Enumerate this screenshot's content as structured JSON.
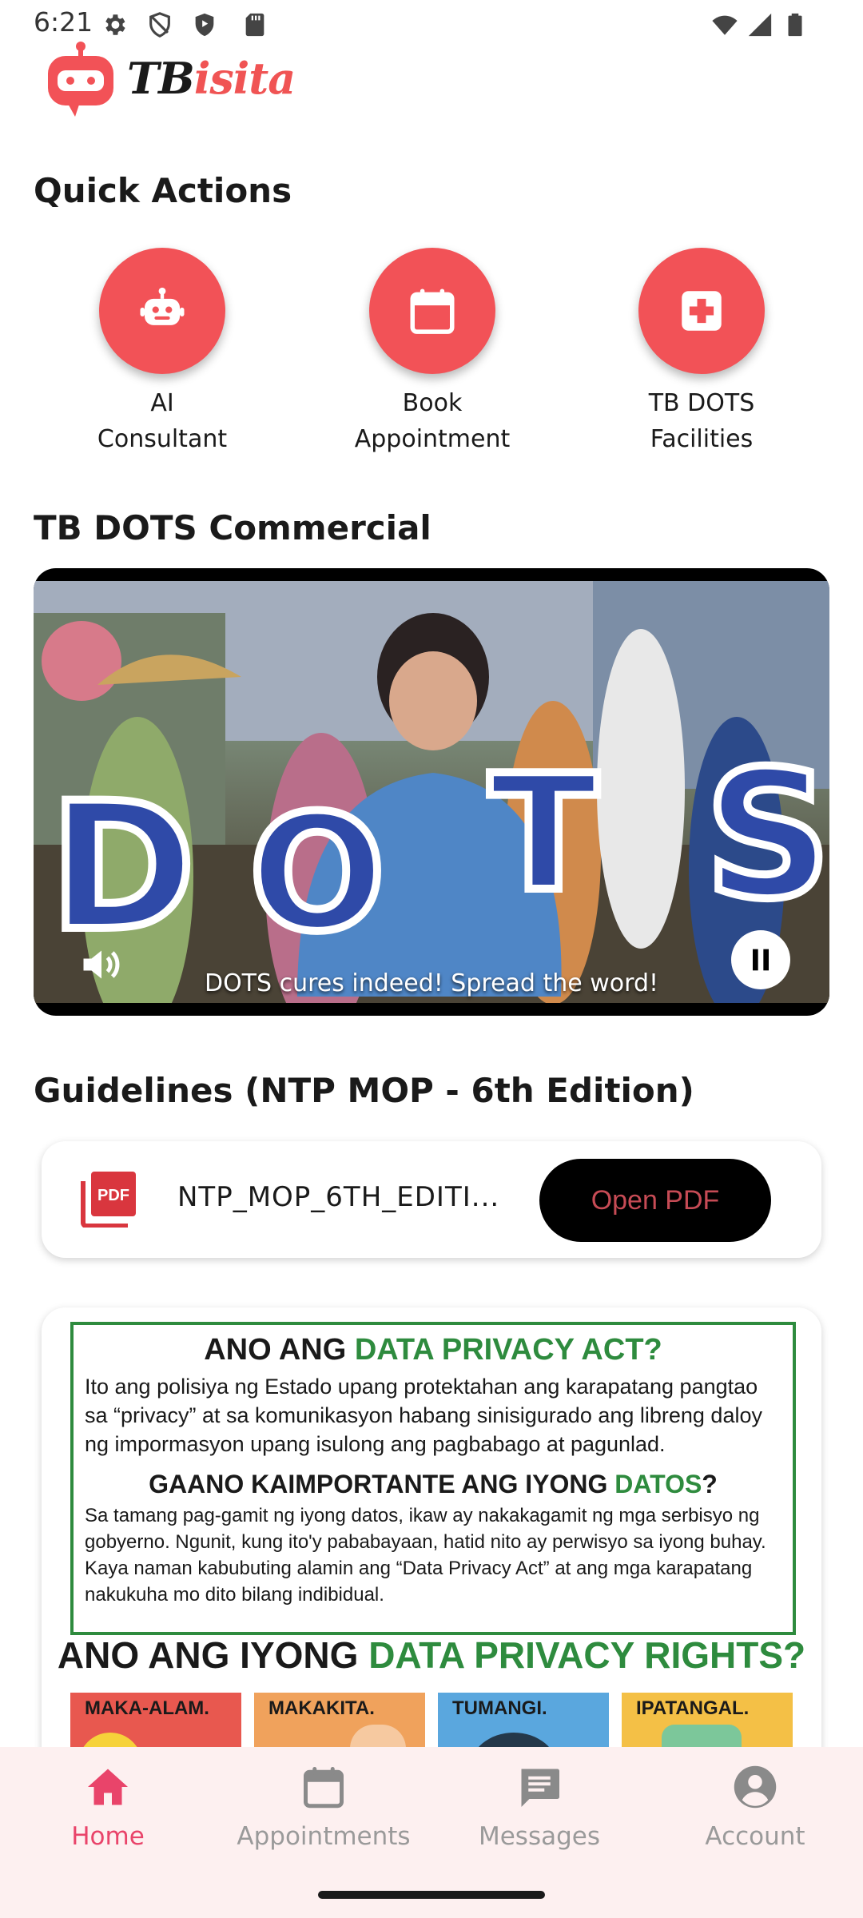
{
  "status_bar": {
    "time": "6:21"
  },
  "app": {
    "logo_prefix": "TB",
    "logo_suffix": "isita"
  },
  "quick_actions": {
    "title": "Quick Actions",
    "items": [
      {
        "label_line1": "AI",
        "label_line2": "Consultant",
        "icon": "robot-icon"
      },
      {
        "label_line1": "Book",
        "label_line2": "Appointment",
        "icon": "calendar-icon"
      },
      {
        "label_line1": "TB DOTS",
        "label_line2": "Facilities",
        "icon": "medical-cross-icon"
      }
    ]
  },
  "commercial": {
    "title": "TB DOTS Commercial",
    "caption": "DOTS cures indeed! Spread the word!",
    "video_letters": [
      "D",
      "O",
      "T",
      "S"
    ]
  },
  "guidelines": {
    "title": "Guidelines (NTP MOP - 6th Edition)",
    "file_name": "NTP_MOP_6TH_EDITI...",
    "open_label": "Open PDF",
    "pdf_badge": "PDF"
  },
  "poster": {
    "q1_prefix": "ANO ANG ",
    "q1_green": "DATA PRIVACY ACT?",
    "p1": "Ito ang polisiya ng Estado upang protektahan ang karapatang pangtao sa “privacy” at sa komunikasyon habang sinisigurado ang libreng daloy ng impormasyon upang isulong ang pagbabago at pagunlad.",
    "q2_prefix": "GAANO KAIMPORTANTE ANG IYONG ",
    "q2_green": "DATOS",
    "q2_suffix": "?",
    "p2": "Sa tamang pag-gamit ng iyong datos, ikaw ay nakakagamit ng mga serbisyo ng gobyerno. Ngunit, kung ito'y pababayaan, hatid nito ay perwisyo sa iyong buhay. Kaya naman kabubuting alamin ang “Data Privacy Act” at ang mga karapatang nakukuha mo dito bilang indibidual.",
    "q3_prefix": "ANO ANG IYONG ",
    "q3_green": "DATA PRIVACY RIGHTS?",
    "tiles": [
      "MAKA-ALAM.",
      "MAKAKITA.",
      "TUMANGI.",
      "IPATANGAL."
    ]
  },
  "bottom_nav": {
    "items": [
      {
        "label": "Home",
        "icon": "home-icon",
        "active": true
      },
      {
        "label": "Appointments",
        "icon": "calendar-icon",
        "active": false
      },
      {
        "label": "Messages",
        "icon": "message-icon",
        "active": false
      },
      {
        "label": "Account",
        "icon": "account-circle-icon",
        "active": false
      }
    ]
  },
  "colors": {
    "accent": "#f25257",
    "nav_active": "#e9446a",
    "nav_bg": "#fdf0f0",
    "poster_green": "#2e8b3e"
  }
}
